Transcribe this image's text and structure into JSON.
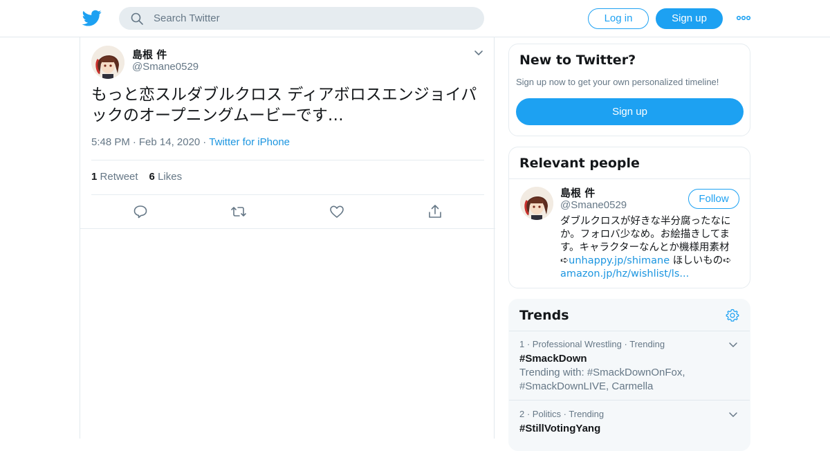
{
  "header": {
    "logo_icon": "twitter-bird-icon",
    "search_placeholder": "Search Twitter",
    "login_label": "Log in",
    "signup_label": "Sign up",
    "more_icon": "more-dots-icon",
    "brand_color": "#1da1f2"
  },
  "tweet": {
    "author_name": "島根 件",
    "author_handle": "@Smane0529",
    "text": "もっと恋スルダブルクロス ディアボロスエンジョイパックのオープニングムービーです…",
    "time": "5:48 PM",
    "date": "Feb 14, 2020",
    "source": "Twitter for iPhone",
    "separator": "·",
    "retweet_count": "1",
    "retweet_label": "Retweet",
    "like_count": "6",
    "like_label": "Likes",
    "actions": [
      "reply-icon",
      "retweet-icon",
      "like-icon",
      "share-icon"
    ]
  },
  "sidebar": {
    "new_to_twitter": {
      "title": "New to Twitter?",
      "subtitle": "Sign up now to get your own personalized timeline!",
      "button_label": "Sign up"
    },
    "relevant_people": {
      "title": "Relevant people",
      "name": "島根 件",
      "handle": "@Smane0529",
      "follow_label": "Follow",
      "bio_text": "ダブルクロスが好きな半分腐ったなにか。フォロバ少なめ。お絵描きしてます。キャラクターなんとか機様用素材➪",
      "bio_link1": "unhappy.jp/shimane",
      "bio_mid": " ほしいもの➪",
      "bio_link2": "amazon.jp/hz/wishlist/ls..."
    },
    "trends": {
      "title": "Trends",
      "settings_icon": "gear-icon",
      "items": [
        {
          "rank": "1",
          "category": "Professional Wrestling",
          "status": "Trending",
          "name": "#SmackDown",
          "with": "Trending with: #SmackDownOnFox, #SmackDownLIVE, Carmella"
        },
        {
          "rank": "2",
          "category": "Politics",
          "status": "Trending",
          "name": "#StillVotingYang",
          "with": ""
        }
      ]
    }
  }
}
